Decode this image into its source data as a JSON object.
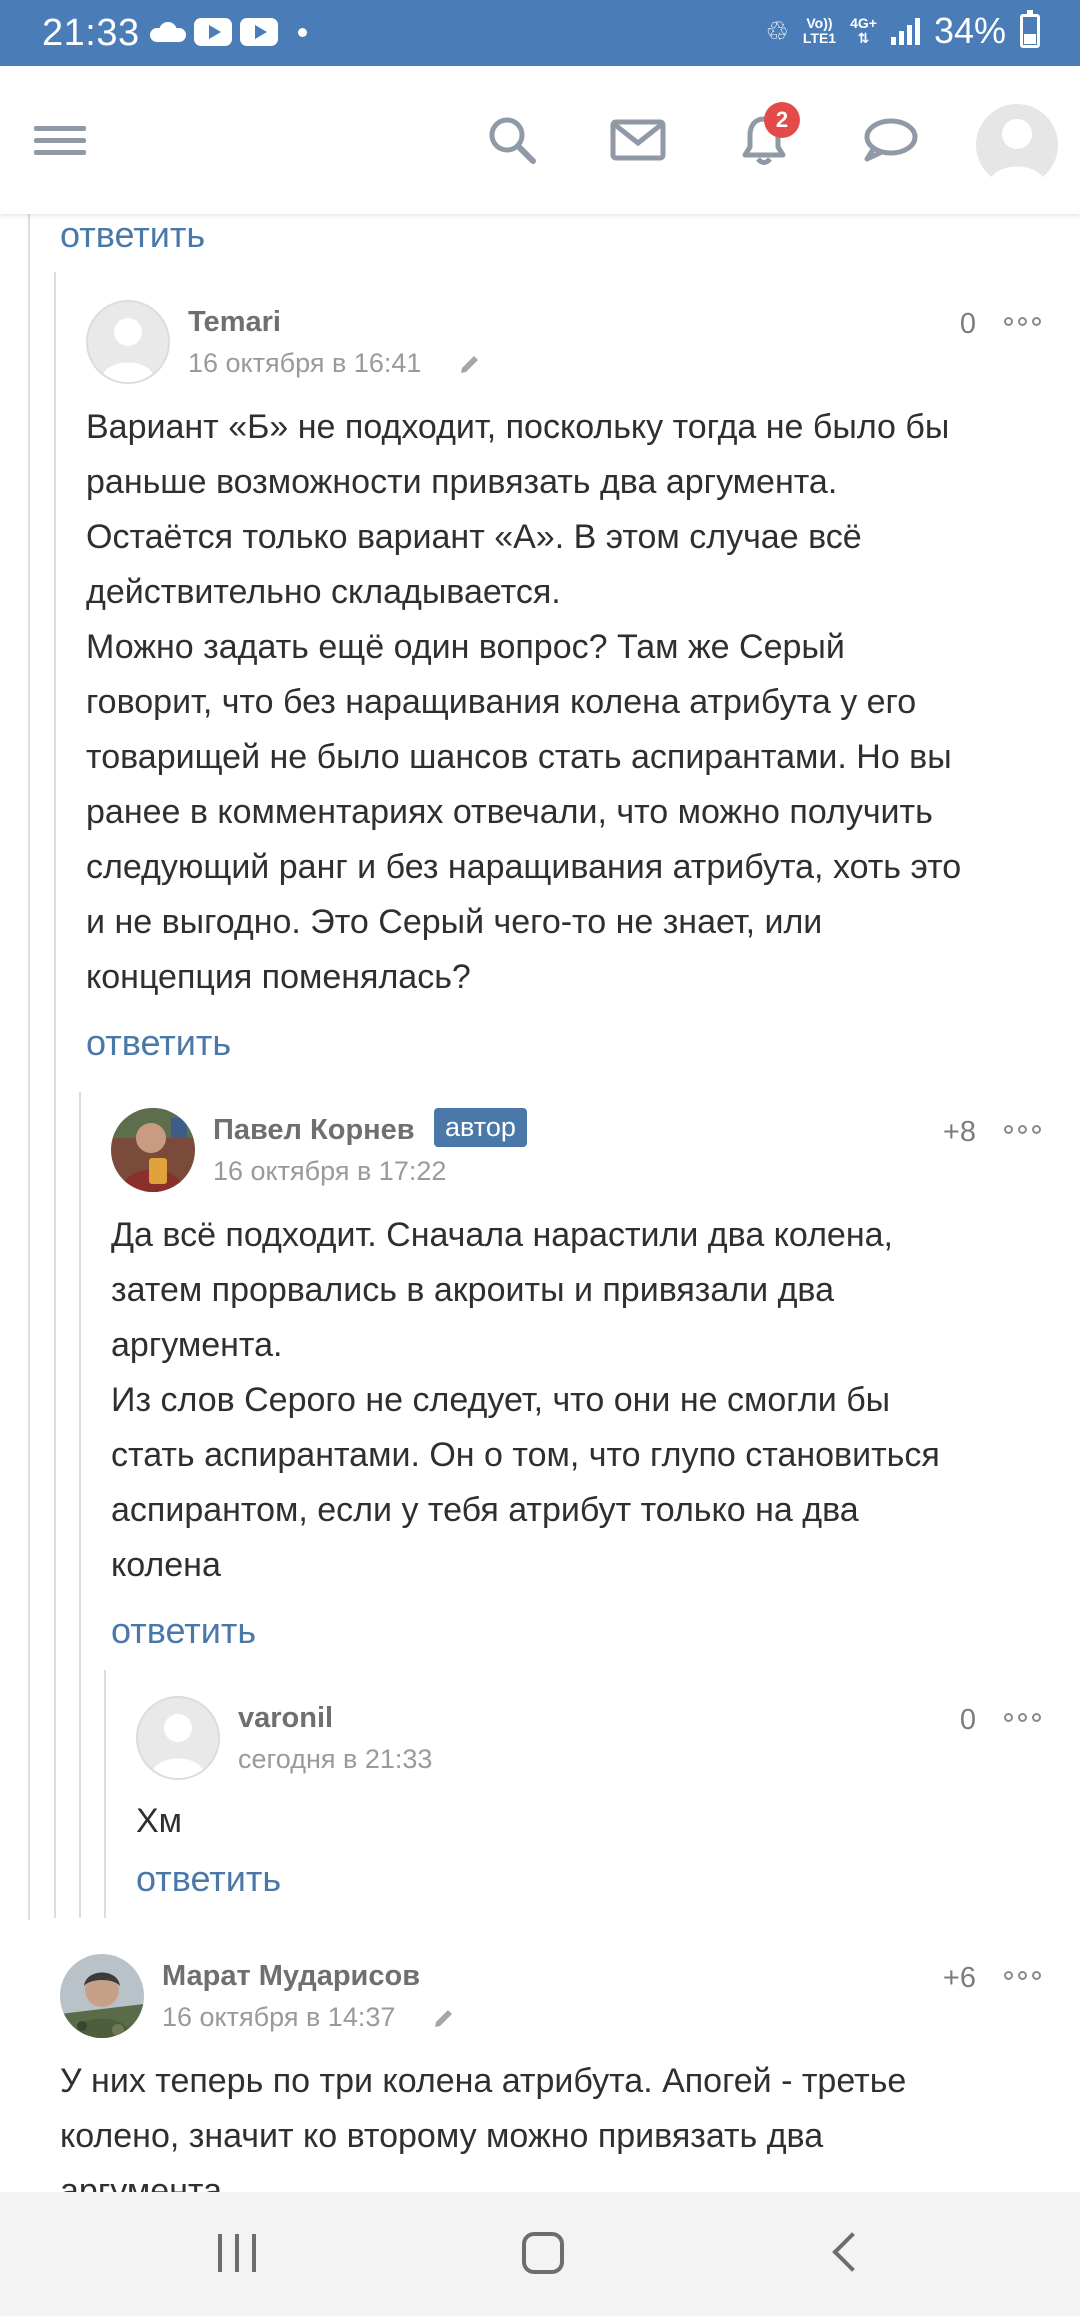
{
  "status_bar": {
    "time": "21:33",
    "network_top": "Vo))",
    "network_bottom": "LTE1",
    "net2_top": "4G+",
    "battery": "34%"
  },
  "nav": {
    "notification_count": "2",
    "icons": [
      "menu-icon",
      "search-icon",
      "mail-icon",
      "bell-icon",
      "chat-icon",
      "avatar-icon"
    ]
  },
  "thread": {
    "top_reply_label": "ответить",
    "comments": [
      {
        "author": "Temari",
        "date": "16 октября в 16:41",
        "score": "0",
        "edited": true,
        "lines": [
          "Вариант «Б» не подходит, поскольку тогда не было бы",
          "раньше возможности привязать два аргумента.",
          "Остаётся только вариант «А». В этом случае всё",
          "действительно складывается.",
          "Можно задать ещё один вопрос? Там же Серый",
          "говорит, что без наращивания колена атрибута у его",
          "товарищей не было шансов стать аспирантами. Но вы",
          "ранее в комментариях отвечали, что можно получить",
          "следующий ранг и без наращивания атрибута, хоть это",
          "и не выгодно. Это Серый чего-то не знает, или",
          "концепция поменялась?"
        ],
        "reply_label": "ответить"
      },
      {
        "author": "Павел Корнев",
        "badge": "автор",
        "date": "16 октября в 17:22",
        "score": "+8",
        "lines": [
          "Да всё подходит. Сначала нарастили два колена,",
          "затем прорвались в акроиты и привязали два",
          "аргумента.",
          "Из слов Серого не следует, что они не смогли бы",
          "стать аспирантами. Он о том, что глупо становиться",
          "аспирантом, если у тебя атрибут только на два",
          "колена"
        ],
        "reply_label": "ответить"
      },
      {
        "author": "varonil",
        "date": "сегодня в 21:33",
        "score": "0",
        "lines": [
          "Хм"
        ],
        "reply_label": "ответить"
      },
      {
        "author": "Марат Мударисов",
        "date": "16 октября в 14:37",
        "score": "+6",
        "edited": true,
        "lines": [
          "У них теперь по три колена атрибута. Апогей - третье",
          "колено, значит ко второму можно привязать два",
          "аргумента."
        ]
      }
    ]
  }
}
